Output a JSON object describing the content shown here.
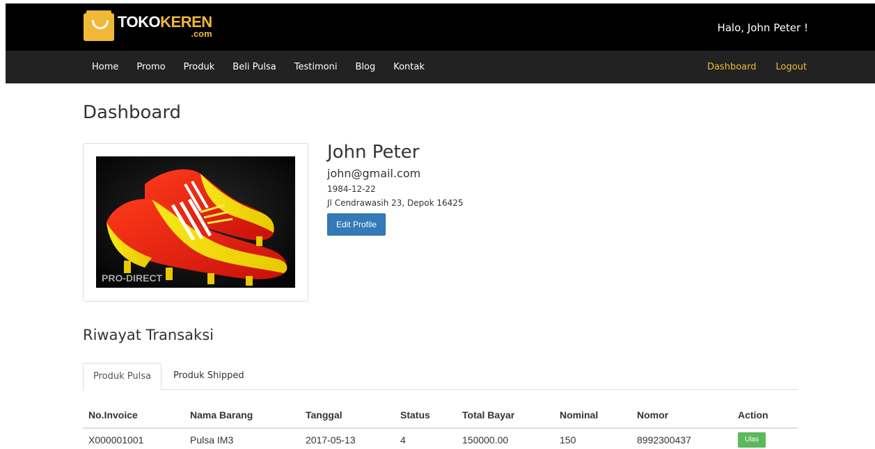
{
  "brand": {
    "part1": "TOKO",
    "part2": "KEREN",
    "suffix": ".com",
    "accent_color": "#f1b838"
  },
  "header": {
    "greeting": "Halo, John Peter !"
  },
  "nav": {
    "left": [
      "Home",
      "Promo",
      "Produk",
      "Beli Pulsa",
      "Testimoni",
      "Blog",
      "Kontak"
    ],
    "right": [
      "Dashboard",
      "Logout"
    ]
  },
  "page": {
    "title": "Dashboard"
  },
  "profile": {
    "name": "John Peter",
    "email": "john@gmail.com",
    "birthdate": "1984-12-22",
    "address": "Jl Cendrawasih 23, Depok 16425",
    "edit_button": "Edit Profile",
    "photo_watermark": "PRO-DIRECT"
  },
  "transactions": {
    "title": "Riwayat Transaksi",
    "tabs": [
      "Produk Pulsa",
      "Produk Shipped"
    ],
    "active_tab": "Produk Pulsa",
    "columns": [
      "No.Invoice",
      "Nama Barang",
      "Tanggal",
      "Status",
      "Total Bayar",
      "Nominal",
      "Nomor",
      "Action"
    ],
    "rows": [
      {
        "invoice": "X000001001",
        "item": "Pulsa IM3",
        "date": "2017-05-13",
        "status": "4",
        "total": "150000.00",
        "nominal": "150",
        "number": "8992300437",
        "action": "Ulas"
      }
    ]
  }
}
